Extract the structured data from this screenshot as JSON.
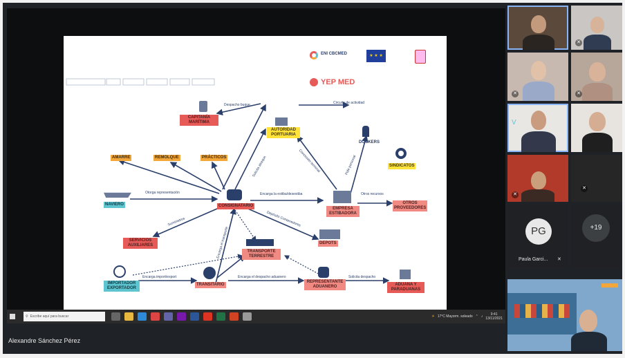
{
  "slide": {
    "brand": "YEP MED",
    "eni_logo": "ENI CBCMED",
    "legend": "Circuito de actividad",
    "nodes": {
      "capitania": "CAPITANÍA MARÍTIMA",
      "autoridad": "AUTORIDAD PORTUARIA",
      "dockers": "DOCKERS",
      "sindicatos": "SINDICATOS",
      "amarre": "AMARRE",
      "remolque": "REMOLQUE",
      "practicos": "PRÁCTICOS",
      "naviero": "NAVIERO",
      "consignatario": "CONSIGNATARIO",
      "empresa": "EMPRESA ESTIBADORA",
      "otros": "OTROS PROVEEDORES",
      "servicios": "SERVICIOS AUXILIARES",
      "depots": "DEPOTS",
      "transporte": "TRANSPORTE TERRESTRE",
      "importador": "IMPORTADOR EXPORTADOR",
      "transitario": "TRANSITARIO",
      "representante": "REPRESENTANTE ADUANERO",
      "aduana": "ADUANA Y PARADUANAS"
    },
    "labels": {
      "despacho_buque": "Despacho buque",
      "solicita_atraque": "Solicita atraque",
      "concesion": "Concesión terminal",
      "pide_personal": "Pide personal",
      "otorga": "Otorga representación",
      "encarga_estiba": "Encarga la estiba/desestiba",
      "otros_recursos": "Otros recursos",
      "deposito": "Depósito Contenedores",
      "suministros": "Suministros",
      "encarga_transporte": "Encarga el transporte",
      "encarga_import": "Encarga import/export",
      "encarga_despacho": "Encarga el despacho aduanero",
      "solicita_despacho": "Solicita despacho"
    }
  },
  "taskbar": {
    "search_placeholder": "Escribe aquí para buscar",
    "weather": "17°C  Mayorm. soleado",
    "time": "9:41",
    "date": "13/11/2021"
  },
  "speaker_name": "Alexandre Sánchez Pérez",
  "participants": {
    "pg_initials": "PG",
    "pg_name": "Paula Garci...",
    "more_count": "+19"
  },
  "colors": {
    "accent_red": "#e65a57",
    "orange": "#f3a63a",
    "yellow": "#ffe23a",
    "teal": "#5ec4cf",
    "arrow_blue": "#2a3f6a",
    "selected_outline": "#8ab4f8"
  }
}
